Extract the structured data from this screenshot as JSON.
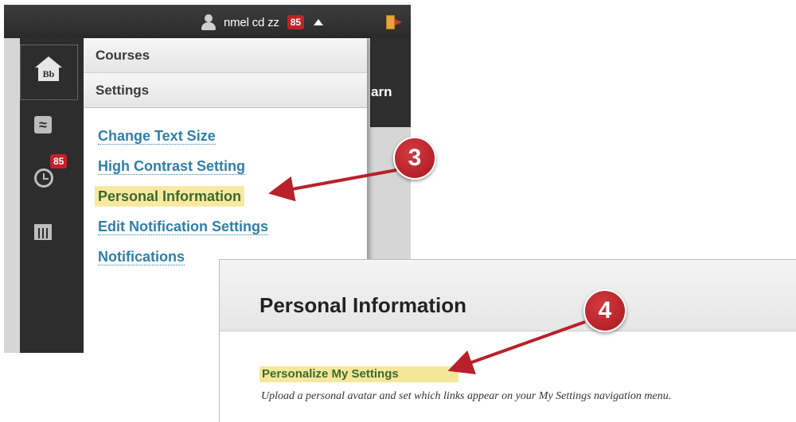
{
  "topbar": {
    "user_name": "nmel cd zz",
    "notification_count": "85"
  },
  "left_nav": {
    "home_logo_text": "Bb",
    "updates_badge": "85",
    "icons": [
      "home-icon",
      "waves-icon",
      "clock-icon",
      "calendar-icon"
    ]
  },
  "menu": {
    "courses_label": "Courses",
    "settings_label": "Settings",
    "links": [
      "Change Text Size",
      "High Contrast Setting",
      "Personal Information",
      "Edit Notification Settings",
      "Notifications"
    ],
    "highlighted_index": 2
  },
  "truncated_text": "arn",
  "annotations": {
    "step_3": "3",
    "step_4": "4",
    "color": "#b9212a"
  },
  "personal_page": {
    "title": "Personal Information",
    "link_label": "Personalize My Settings",
    "description": "Upload a personal avatar and set which links appear on your My Settings navigation menu."
  },
  "colors": {
    "link_blue": "#2f7fa9",
    "highlight_yellow": "#f8e9a1",
    "badge_red": "#c4202a",
    "dark_bar": "#2d2d2d"
  }
}
